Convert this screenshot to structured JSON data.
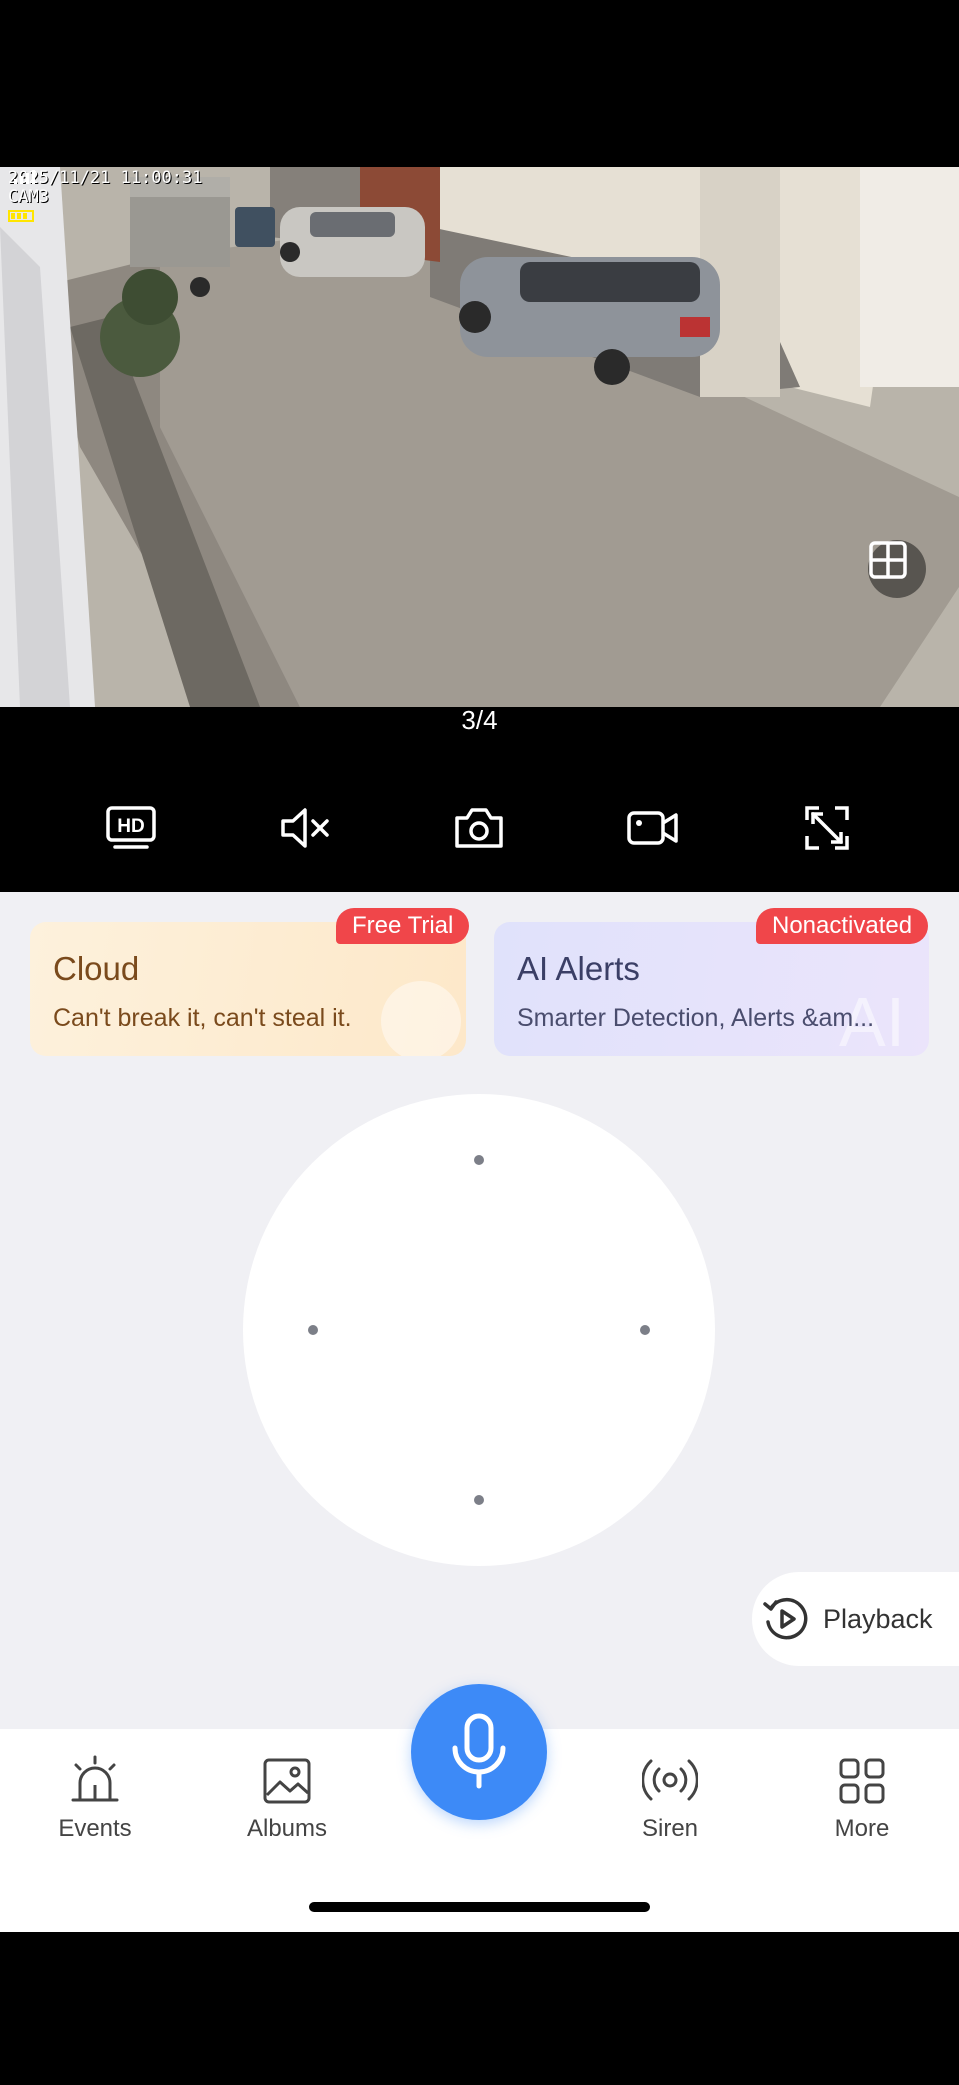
{
  "video": {
    "timestamp": "2025/11/21 11:00:31",
    "camera_name": "CAM3",
    "page_indicator": "3/4"
  },
  "toolbar": {
    "icons": [
      "hd-icon",
      "mute-icon",
      "camera-icon",
      "record-icon",
      "fullscreen-icon"
    ]
  },
  "cards": {
    "cloud": {
      "badge": "Free Trial",
      "title": "Cloud",
      "subtitle": "Can't break it, can't steal it."
    },
    "ai": {
      "badge": "Nonactivated",
      "title": "AI Alerts",
      "subtitle": "Smarter Detection, Alerts &am..."
    }
  },
  "playback": {
    "label": "Playback"
  },
  "nav": {
    "events": "Events",
    "albums": "Albums",
    "siren": "Siren",
    "more": "More"
  },
  "colors": {
    "accent_blue": "#3d8af7",
    "badge_red": "#f0464a",
    "panel_bg": "#f0f0f4"
  }
}
